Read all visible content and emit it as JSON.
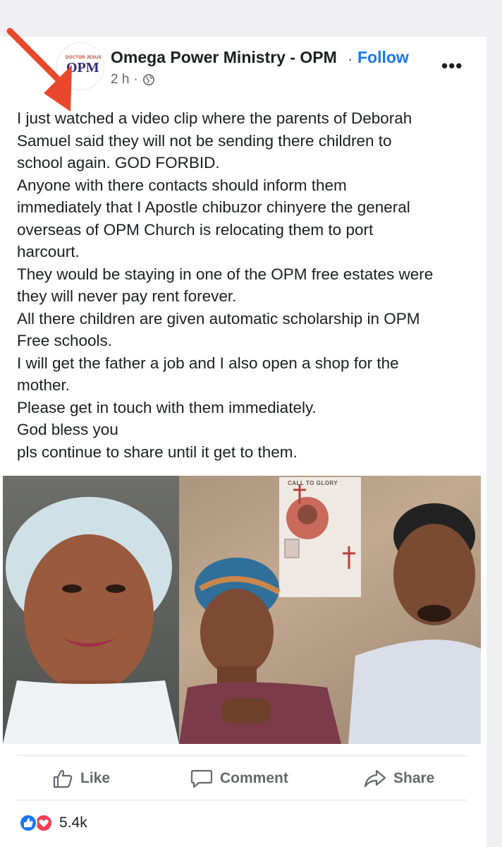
{
  "post": {
    "page_name": "Omega Power Ministry - OPM",
    "separator": "·",
    "follow_label": "Follow",
    "time": "2 h",
    "time_separator": "·",
    "more_label": "•••",
    "avatar_top_text": "DOCTOR JESUS",
    "avatar_main_text": "OPM",
    "text_lines": [
      "I just watched a video clip where the parents of Deborah",
      "Samuel said they will not be sending there children to",
      "school again. GOD FORBID.",
      "Anyone with there contacts should inform them",
      "immediately that I Apostle chibuzor chinyere the general",
      "overseas of OPM Church is relocating them to port",
      "harcourt.",
      "They would be staying in one of the OPM free estates were",
      "they will never pay rent forever.",
      "All there children are given automatic scholarship in OPM",
      "Free schools.",
      "I will get the father a job and I also open a shop for the",
      "mother.",
      "Please get in touch with them immediately.",
      "God bless you",
      "pls continue to share until it get to them."
    ],
    "photo_poster_text": "CALL TO GLORY"
  },
  "actions": {
    "like_label": "Like",
    "comment_label": "Comment",
    "share_label": "Share"
  },
  "reactions": {
    "count": "5.4k"
  },
  "colors": {
    "accent": "#1877f2",
    "arrow": "#e8472b",
    "love": "#f33e58"
  }
}
